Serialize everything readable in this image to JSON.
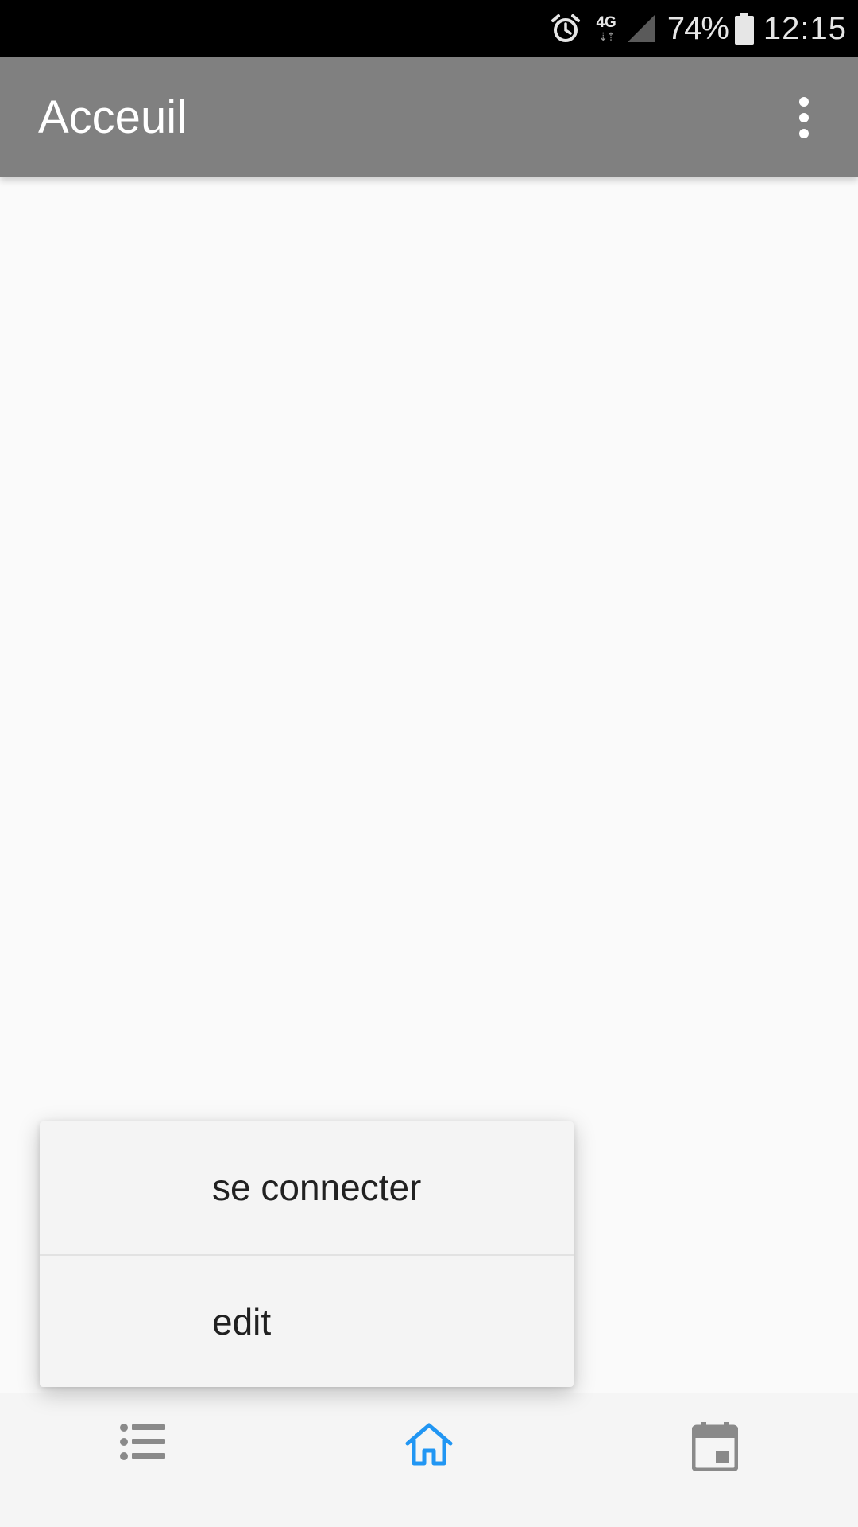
{
  "status_bar": {
    "network": "4G",
    "battery_percent": "74%",
    "time": "12:15",
    "icons": [
      "alarm-icon",
      "network-4g-icon",
      "signal-icon",
      "battery-icon"
    ]
  },
  "app_bar": {
    "title": "Acceuil",
    "overflow_icon": "more-vert-icon"
  },
  "popup_menu": {
    "items": [
      {
        "label": "se connecter"
      },
      {
        "label": "edit"
      }
    ]
  },
  "bottom_nav": {
    "items": [
      {
        "icon": "list-icon",
        "active": false
      },
      {
        "icon": "home-icon",
        "active": true
      },
      {
        "icon": "calendar-icon",
        "active": false
      }
    ]
  },
  "colors": {
    "app_bar": "#808080",
    "status_bar": "#000000",
    "background": "#fafafa",
    "active_nav": "#2196f3",
    "inactive_nav": "#8a8a8a"
  }
}
